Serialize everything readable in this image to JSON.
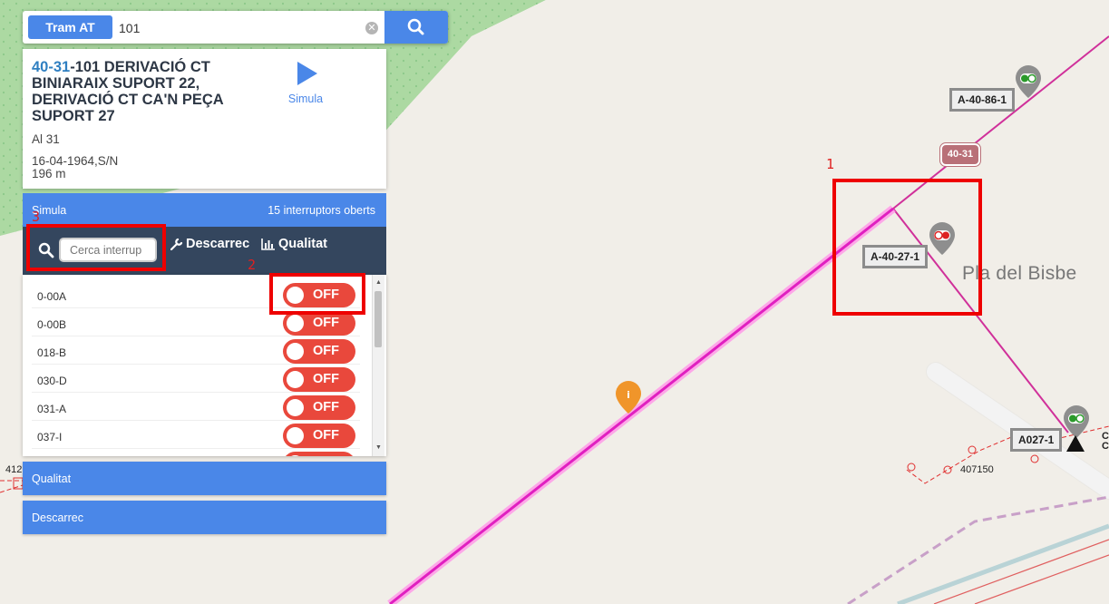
{
  "search": {
    "type_button": "Tram AT",
    "query": "101",
    "clear_icon": "clear-circle-icon",
    "go_icon": "search-icon"
  },
  "info": {
    "code": "40-31",
    "name_lines": [
      "-101 DERIVACIÓ CT",
      "BINIARAIX SUPORT 22,",
      "DERIVACIÓ CT CA'N PEÇA",
      "SUPORT 27"
    ],
    "material": "Al 31",
    "date_info": "16-04-1964,S/N",
    "length": "196 m",
    "simula_label": "Simula"
  },
  "simula_panel": {
    "title": "Simula",
    "open_count": "15 interruptors oberts"
  },
  "toolbar": {
    "search_placeholder": "Cerca interrup",
    "descarrec_label": "Descarrec",
    "qualitat_label": "Qualitat"
  },
  "switches": [
    {
      "id": "0-00A",
      "state": "OFF"
    },
    {
      "id": "0-00B",
      "state": "OFF"
    },
    {
      "id": "018-B",
      "state": "OFF"
    },
    {
      "id": "030-D",
      "state": "OFF"
    },
    {
      "id": "031-A",
      "state": "OFF"
    },
    {
      "id": "037-I",
      "state": "OFF"
    },
    {
      "id": "",
      "state": "OFF"
    }
  ],
  "accordion": {
    "qualitat": "Qualitat",
    "descarrec": "Descarrec"
  },
  "map": {
    "labels": {
      "a_40_86_1": "A-40-86-1",
      "a_40_27_1": "A-40-27-1",
      "a027_1": "A027-1",
      "line_badge": "40-31",
      "place": "Pla del Bisbe",
      "num_407150": "407150",
      "num_412": "412",
      "edge_c": "C\nC"
    }
  },
  "annotations": [
    "1",
    "2",
    "3"
  ],
  "colors": {
    "accent": "#4a87e8",
    "toolbar": "#34465e",
    "switch_off": "#e9483c",
    "selected_line": "#ff40d8",
    "network_line": "#d0309a",
    "annotation": "#ee0000"
  }
}
